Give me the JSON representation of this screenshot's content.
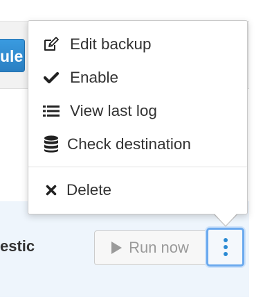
{
  "background": {
    "schedule_button_label": "ule",
    "row_name": "estic",
    "run_now_label": "Run now",
    "accent_color": "#2a8ad3",
    "row_highlight_color": "#eef5fc"
  },
  "menu": {
    "items": [
      {
        "label": "Edit backup",
        "icon": "edit-icon"
      },
      {
        "label": "Enable",
        "icon": "check-icon"
      },
      {
        "label": "View last log",
        "icon": "list-icon"
      },
      {
        "label": "Check destination",
        "icon": "database-icon"
      }
    ],
    "danger_items": [
      {
        "label": "Delete",
        "icon": "close-icon"
      }
    ]
  }
}
